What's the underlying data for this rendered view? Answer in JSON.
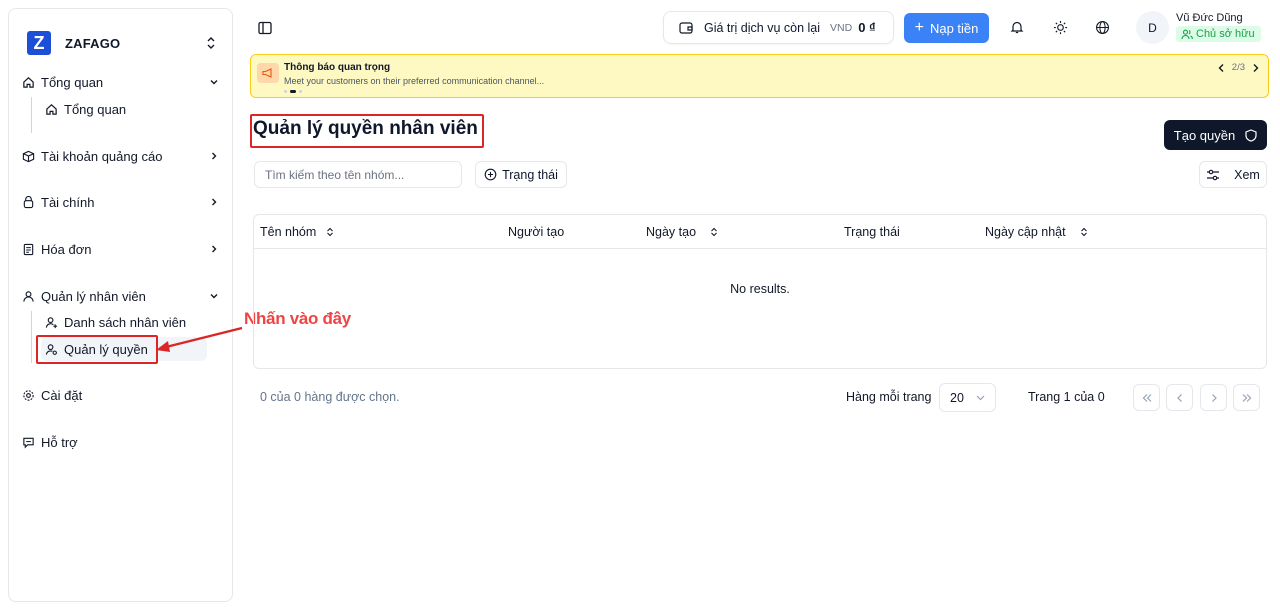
{
  "brand": {
    "name": "ZAFAGO",
    "logo_letter": "Z"
  },
  "sidebar": {
    "items": [
      {
        "label": "Tổng quan",
        "icon": "home-icon"
      },
      {
        "label": "Tổng quan",
        "icon": "home-icon",
        "sub": true
      },
      {
        "label": "Tài khoản quảng cáo",
        "icon": "box-icon"
      },
      {
        "label": "Tài chính",
        "icon": "wallet-icon"
      },
      {
        "label": "Hóa đơn",
        "icon": "receipt-icon"
      },
      {
        "label": "Quản lý nhân viên",
        "icon": "user-icon"
      },
      {
        "label": "Danh sách nhân viên",
        "icon": "user-plus-icon",
        "sub": true
      },
      {
        "label": "Quản lý quyền",
        "icon": "user-key-icon",
        "sub": true,
        "active": true
      },
      {
        "label": "Cài đặt",
        "icon": "gear-icon"
      },
      {
        "label": "Hỗ trợ",
        "icon": "message-icon"
      }
    ]
  },
  "header": {
    "balance_label": "Giá trị dịch vụ còn lại",
    "currency": "VND",
    "balance_amount": "0 ₫",
    "topup_label": "Nạp tiền",
    "user_initial": "D",
    "user_name": "Vũ Đức Dũng",
    "user_role": "Chủ sở hữu"
  },
  "notice": {
    "title": "Thông báo quan trọng",
    "message": "Meet your customers on their preferred communication channel...",
    "pager": "2/3"
  },
  "page": {
    "title": "Quản lý quyền nhân viên",
    "create_label": "Tạo quyền",
    "search_placeholder": "Tìm kiếm theo tên nhóm...",
    "filter_label": "Trạng thái",
    "view_label": "Xem"
  },
  "table": {
    "columns": [
      "Tên nhóm",
      "Người tạo",
      "Ngày tạo",
      "Trạng thái",
      "Ngày cập nhật"
    ],
    "empty_text": "No results."
  },
  "footer": {
    "selected_text": "0 của 0 hàng được chọn.",
    "rows_per_page_label": "Hàng mỗi trang",
    "rows_per_page_value": "20",
    "page_text": "Trang 1 của 0"
  },
  "annotation": {
    "text": "Nhấn vào đây",
    "color": "#ef4444"
  },
  "colors": {
    "primary": "#3b82f6",
    "dark": "#0f172a",
    "notice_bg": "#fef9c3",
    "success": "#16a34a"
  }
}
